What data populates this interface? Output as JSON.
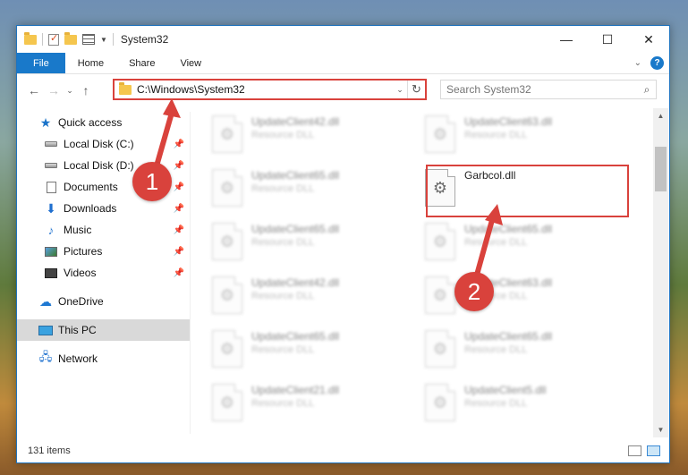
{
  "window": {
    "title": "System32"
  },
  "titlebar": {
    "minimize": "—",
    "maximize": "☐",
    "close": "✕"
  },
  "ribbon": {
    "tabs": [
      "File",
      "Home",
      "Share",
      "View"
    ],
    "expand": "⌄",
    "help": "?"
  },
  "nav": {
    "back": "←",
    "forward": "→",
    "recent": "⌄",
    "up": "↑",
    "address": "C:\\Windows\\System32",
    "address_dropdown": "⌄",
    "refresh": "↻",
    "search_placeholder": "Search System32",
    "search_icon": "⌕"
  },
  "sidebar": {
    "items": [
      {
        "label": "Quick access",
        "icon": "star-icon"
      },
      {
        "label": "Local Disk (C:)",
        "icon": "disk-icon",
        "pinned": true
      },
      {
        "label": "Local Disk (D:)",
        "icon": "disk-icon",
        "pinned": true
      },
      {
        "label": "Documents",
        "icon": "documents-icon",
        "pinned": true
      },
      {
        "label": "Downloads",
        "icon": "downloads-icon",
        "pinned": true
      },
      {
        "label": "Music",
        "icon": "music-icon",
        "pinned": true
      },
      {
        "label": "Pictures",
        "icon": "pictures-icon",
        "pinned": true
      },
      {
        "label": "Videos",
        "icon": "videos-icon",
        "pinned": true
      },
      {
        "label": "OneDrive",
        "icon": "onedrive-icon"
      },
      {
        "label": "This PC",
        "icon": "pc-icon",
        "selected": true
      },
      {
        "label": "Network",
        "icon": "network-icon"
      }
    ],
    "pin_glyph": "📌"
  },
  "files": [
    {
      "name": "UpdateClient42.dll",
      "type": "Resource DLL"
    },
    {
      "name": "UpdateClient63.dll",
      "type": "Resource DLL"
    },
    {
      "name": "UpdateClient65.dll",
      "type": "Resource DLL"
    },
    {
      "name": "Garbcol.dll",
      "type": ""
    },
    {
      "name": "UpdateClient65.dll",
      "type": "Resource DLL"
    },
    {
      "name": "UpdateClient65.dll",
      "type": "Resource DLL"
    },
    {
      "name": "UpdateClient42.dll",
      "type": "Resource DLL"
    },
    {
      "name": "UpdateClient63.dll",
      "type": "Resource DLL"
    },
    {
      "name": "UpdateClient65.dll",
      "type": "Resource DLL"
    },
    {
      "name": "UpdateClient65.dll",
      "type": "Resource DLL"
    },
    {
      "name": "UpdateClient21.dll",
      "type": "Resource DLL"
    },
    {
      "name": "UpdateClient5.dll",
      "type": "Resource DLL"
    }
  ],
  "status": {
    "item_count": "131 items"
  },
  "callouts": {
    "first": "1",
    "second": "2"
  },
  "colors": {
    "accent": "#1979ca",
    "highlight": "#d9423c"
  }
}
